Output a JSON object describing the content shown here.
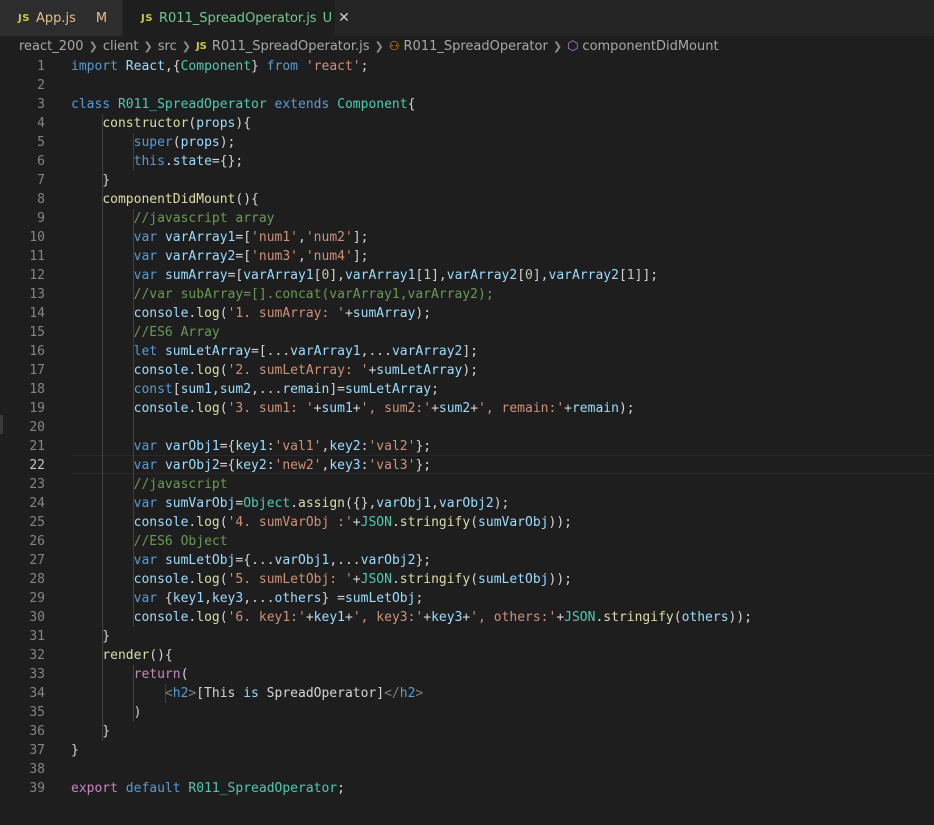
{
  "tabs": [
    {
      "icon": "JS",
      "label": "App.js",
      "status": "M"
    },
    {
      "icon": "JS",
      "label": "R011_SpreadOperator.js",
      "status": "U",
      "close": "✕"
    }
  ],
  "breadcrumb": {
    "items": [
      "react_200",
      "client",
      "src",
      "R011_SpreadOperator.js",
      "R011_SpreadOperator",
      "componentDidMount"
    ],
    "file_icon": "JS"
  },
  "editor": {
    "active_line": 22,
    "lines": [
      {
        "n": 1,
        "text": "import React,{Component} from 'react';"
      },
      {
        "n": 2,
        "text": ""
      },
      {
        "n": 3,
        "text": "class R011_SpreadOperator extends Component{"
      },
      {
        "n": 4,
        "text": "    constructor(props){"
      },
      {
        "n": 5,
        "text": "        super(props);"
      },
      {
        "n": 6,
        "text": "        this.state={};"
      },
      {
        "n": 7,
        "text": "    }"
      },
      {
        "n": 8,
        "text": "    componentDidMount(){"
      },
      {
        "n": 9,
        "text": "        //javascript array"
      },
      {
        "n": 10,
        "text": "        var varArray1=['num1','num2'];"
      },
      {
        "n": 11,
        "text": "        var varArray2=['num3','num4'];"
      },
      {
        "n": 12,
        "text": "        var sumArray=[varArray1[0],varArray1[1],varArray2[0],varArray2[1]];"
      },
      {
        "n": 13,
        "text": "        //var subArray=[].concat(varArray1,varArray2);"
      },
      {
        "n": 14,
        "text": "        console.log('1. sumArray: '+sumArray);"
      },
      {
        "n": 15,
        "text": "        //ES6 Array"
      },
      {
        "n": 16,
        "text": "        let sumLetArray=[...varArray1,...varArray2];"
      },
      {
        "n": 17,
        "text": "        console.log('2. sumLetArray: '+sumLetArray);"
      },
      {
        "n": 18,
        "text": "        const[sum1,sum2,...remain]=sumLetArray;"
      },
      {
        "n": 19,
        "text": "        console.log('3. sum1: '+sum1+', sum2:'+sum2+', remain:'+remain);"
      },
      {
        "n": 20,
        "text": ""
      },
      {
        "n": 21,
        "text": "        var varObj1={key1:'val1',key2:'val2'};"
      },
      {
        "n": 22,
        "text": "        var varObj2={key2:'new2',key3:'val3'};"
      },
      {
        "n": 23,
        "text": "        //javascript"
      },
      {
        "n": 24,
        "text": "        var sumVarObj=Object.assign({},varObj1,varObj2);"
      },
      {
        "n": 25,
        "text": "        console.log('4. sumVarObj :'+JSON.stringify(sumVarObj));"
      },
      {
        "n": 26,
        "text": "        //ES6 Object"
      },
      {
        "n": 27,
        "text": "        var sumLetObj={...varObj1,...varObj2};"
      },
      {
        "n": 28,
        "text": "        console.log('5. sumLetObj: '+JSON.stringify(sumLetObj));"
      },
      {
        "n": 29,
        "text": "        var {key1,key3,...others} =sumLetObj;"
      },
      {
        "n": 30,
        "text": "        console.log('6. key1:'+key1+', key3:'+key3+', others:'+JSON.stringify(others));"
      },
      {
        "n": 31,
        "text": "    }"
      },
      {
        "n": 32,
        "text": "    render(){"
      },
      {
        "n": 33,
        "text": "        return("
      },
      {
        "n": 34,
        "text": "            <h2>[This is SpreadOperator]</h2>"
      },
      {
        "n": 35,
        "text": "        )"
      },
      {
        "n": 36,
        "text": "    }"
      },
      {
        "n": 37,
        "text": "}"
      },
      {
        "n": 38,
        "text": ""
      },
      {
        "n": 39,
        "text": "export default R011_SpreadOperator;"
      }
    ]
  },
  "colors": {
    "keyword": "#569cd6",
    "control": "#c586c0",
    "string": "#ce9178",
    "comment": "#6a9955",
    "type": "#4ec9b0",
    "variable": "#9cdcfe",
    "function": "#dcdcaa",
    "number": "#b5cea8",
    "punct": "#d4d4d4"
  }
}
